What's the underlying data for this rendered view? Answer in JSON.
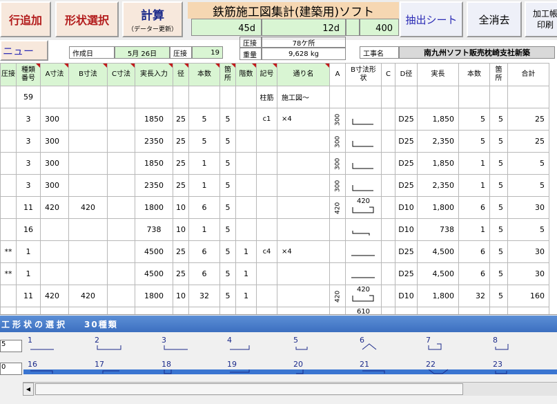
{
  "toolbar": {
    "add_row": "行追加",
    "shape_select": "形状選択",
    "calc": "計算",
    "calc_sub": "（データー更新）",
    "title": "鉄筋施工図集計(建築用)ソフト",
    "extract_sheet": "抽出シート",
    "clear_all": "全消去",
    "print_line1": "加工帳",
    "print_line2": "印刷",
    "sum_a": "45d",
    "sum_b": "12d",
    "sum_c": "400"
  },
  "info": {
    "menu": "ニュー",
    "date_label": "作成日",
    "date_value": "5月 26日",
    "press_label": "圧接",
    "press_value": "19",
    "press_label2": "圧接",
    "press_count": "78ケ所",
    "weight_label": "重量",
    "weight_value": "9,628 kg",
    "project_label": "工事名",
    "project_value": "南九州ソフト販売枕崎支社新築"
  },
  "headers": [
    "圧接",
    "種類\n番号",
    "A寸法",
    "B寸法",
    "C寸法",
    "実長入力",
    "径",
    "本数",
    "箇\n所",
    "階数",
    "記号",
    "通り名",
    "A",
    "B寸法形\n状",
    "C",
    "D径",
    "実長",
    "本数",
    "箇\n所",
    "合計"
  ],
  "rows": [
    {
      "press": "",
      "type": "59",
      "a": "",
      "b": "",
      "c": "",
      "len": "",
      "dia": "",
      "count": "",
      "place": "",
      "floor": "",
      "sym": "柱筋",
      "line": "施工図〜",
      "ra": "",
      "shape": "",
      "b_label": "",
      "rc": "",
      "d": "",
      "rlen": "",
      "rcount": "",
      "rplace": "",
      "total": ""
    },
    {
      "press": "",
      "type": "3",
      "a": "300",
      "b": "",
      "c": "",
      "len": "1850",
      "dia": "25",
      "count": "5",
      "place": "5",
      "floor": "",
      "sym": "c1",
      "line": "×4",
      "ra": "300",
      "shape": "L",
      "b_label": "",
      "rc": "",
      "d": "D25",
      "rlen": "1,850",
      "rcount": "5",
      "rplace": "5",
      "total": "25"
    },
    {
      "press": "",
      "type": "3",
      "a": "300",
      "b": "",
      "c": "",
      "len": "2350",
      "dia": "25",
      "count": "5",
      "place": "5",
      "floor": "",
      "sym": "",
      "line": "",
      "ra": "300",
      "shape": "L",
      "b_label": "",
      "rc": "",
      "d": "D25",
      "rlen": "2,350",
      "rcount": "5",
      "rplace": "5",
      "total": "25"
    },
    {
      "press": "",
      "type": "3",
      "a": "300",
      "b": "",
      "c": "",
      "len": "1850",
      "dia": "25",
      "count": "1",
      "place": "5",
      "floor": "",
      "sym": "",
      "line": "",
      "ra": "300",
      "shape": "L",
      "b_label": "",
      "rc": "",
      "d": "D25",
      "rlen": "1,850",
      "rcount": "1",
      "rplace": "5",
      "total": "5"
    },
    {
      "press": "",
      "type": "3",
      "a": "300",
      "b": "",
      "c": "",
      "len": "2350",
      "dia": "25",
      "count": "1",
      "place": "5",
      "floor": "",
      "sym": "",
      "line": "",
      "ra": "300",
      "shape": "L",
      "b_label": "",
      "rc": "",
      "d": "D25",
      "rlen": "2,350",
      "rcount": "1",
      "rplace": "5",
      "total": "5"
    },
    {
      "press": "",
      "type": "11",
      "a": "420",
      "b": "420",
      "c": "",
      "len": "1800",
      "dia": "10",
      "count": "6",
      "place": "5",
      "floor": "",
      "sym": "",
      "line": "",
      "ra": "420",
      "shape": "box",
      "b_label": "420",
      "rc": "",
      "d": "D10",
      "rlen": "1,800",
      "rcount": "6",
      "rplace": "5",
      "total": "30"
    },
    {
      "press": "",
      "type": "16",
      "a": "",
      "b": "",
      "c": "",
      "len": "738",
      "dia": "10",
      "count": "1",
      "place": "5",
      "floor": "",
      "sym": "",
      "line": "",
      "ra": "",
      "shape": "hook",
      "b_label": "",
      "rc": "",
      "d": "D10",
      "rlen": "738",
      "rcount": "1",
      "rplace": "5",
      "total": "5"
    },
    {
      "press": "**",
      "type": "1",
      "a": "",
      "b": "",
      "c": "",
      "len": "4500",
      "dia": "25",
      "count": "6",
      "place": "5",
      "floor": "1",
      "sym": "c4",
      "line": "×4",
      "ra": "",
      "shape": "line",
      "b_label": "",
      "rc": "",
      "d": "D25",
      "rlen": "4,500",
      "rcount": "6",
      "rplace": "5",
      "total": "30"
    },
    {
      "press": "**",
      "type": "1",
      "a": "",
      "b": "",
      "c": "",
      "len": "4500",
      "dia": "25",
      "count": "6",
      "place": "5",
      "floor": "1",
      "sym": "",
      "line": "",
      "ra": "",
      "shape": "line",
      "b_label": "",
      "rc": "",
      "d": "D25",
      "rlen": "4,500",
      "rcount": "6",
      "rplace": "5",
      "total": "30"
    },
    {
      "press": "",
      "type": "11",
      "a": "420",
      "b": "420",
      "c": "",
      "len": "1800",
      "dia": "10",
      "count": "32",
      "place": "5",
      "floor": "1",
      "sym": "",
      "line": "",
      "ra": "420",
      "shape": "box",
      "b_label": "420",
      "rc": "",
      "d": "D10",
      "rlen": "1,800",
      "rcount": "32",
      "rplace": "5",
      "total": "160"
    },
    {
      "press": "",
      "type": "",
      "a": "",
      "b": "",
      "c": "",
      "len": "",
      "dia": "",
      "count": "",
      "place": "",
      "floor": "",
      "sym": "",
      "line": "",
      "ra": "",
      "shape": "",
      "b_label": "610",
      "rc": "",
      "d": "",
      "rlen": "",
      "rcount": "",
      "rplace": "",
      "total": ""
    }
  ],
  "panel": {
    "title": "工形状の選択",
    "count": "30種類",
    "field1": "5",
    "field2": "0",
    "shapes_row1": [
      "1",
      "2",
      "3",
      "4",
      "5",
      "6",
      "7",
      "8"
    ],
    "shapes_row2": [
      "16",
      "17",
      "18",
      "19",
      "20",
      "21",
      "22",
      "23"
    ]
  },
  "colors": {
    "button_face": "#f7e8dc",
    "button_red_text": "#b31d1d",
    "header_green": "#d9f5d3",
    "title_orange": "#f6d7b2",
    "panel_blue": "#3c6fc0"
  }
}
